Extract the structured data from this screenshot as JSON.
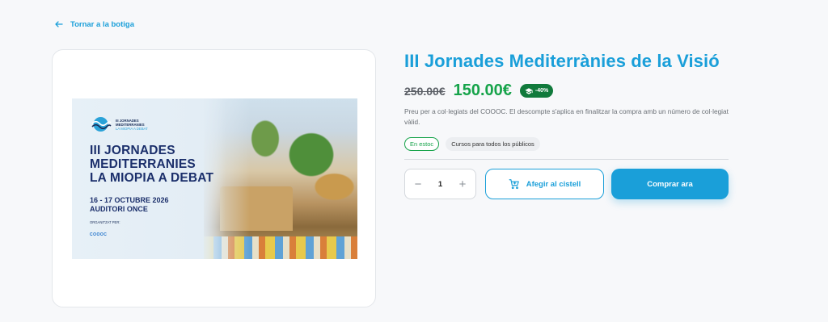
{
  "nav": {
    "back_label": "Tornar a la botiga"
  },
  "banner": {
    "logo_line1": "III JORNADES",
    "logo_line2": "MEDITERRANIES",
    "logo_line3": "LA MIOPIA A DEBAT",
    "headline_line1": "III JORNADES",
    "headline_line2": "MEDITERRANIES",
    "headline_line3": "LA MIOPIA A DEBAT",
    "date": "16 - 17 OCTUBRE 2026",
    "venue": "AUDITORI ONCE",
    "organizer_label": "ORGANITZAT PER:",
    "organizer_logo": "COOOC"
  },
  "product": {
    "title": "III Jornades Mediterrànies de la Visió",
    "old_price": "250.00€",
    "new_price": "150.00€",
    "discount": "-40%",
    "description": "Preu per a col·legiats del COOOC. El descompte s'aplica en finalitzar la compra amb un número de col·legiat vàlid.",
    "stock_tag": "En estoc",
    "course_tag": "Cursos para todos los públicos"
  },
  "purchase": {
    "quantity": "1",
    "minus": "−",
    "plus": "+",
    "add_to_cart": "Afegir al cistell",
    "buy_now": "Comprar ara"
  },
  "colors": {
    "accent": "#1a9fd9",
    "price_green": "#16a34a",
    "badge_green": "#117a3c",
    "banner_navy": "#1b2f6b"
  }
}
